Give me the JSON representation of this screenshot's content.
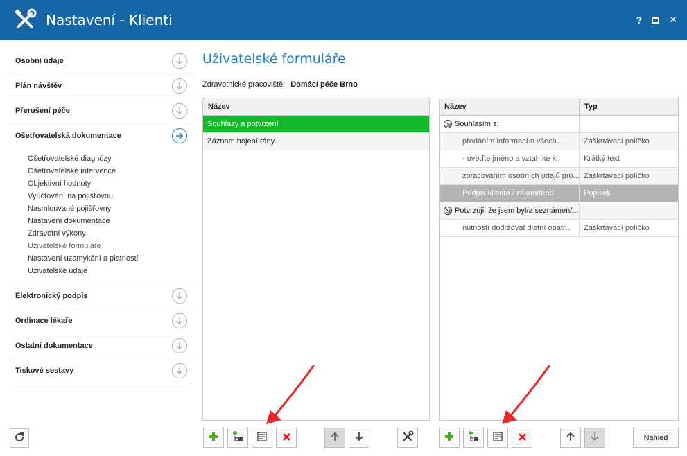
{
  "window": {
    "title": "Nastavení - Klienti",
    "help": "?",
    "close": "✕"
  },
  "sidebar": {
    "sections_top": [
      {
        "label": "Osobní údaje"
      },
      {
        "label": "Plán návštěv"
      },
      {
        "label": "Přerušení péče"
      },
      {
        "label": "Ošetřovatelská dokumentace"
      }
    ],
    "subitems": [
      "Ošetřovatelské diagnózy",
      "Ošetřovatelské intervence",
      "Objektivní hodnoty",
      "Vyúčtování na pojišťovnu",
      "Nasmlouvané pojišťovny",
      "Nastavení dokumentace",
      "Zdravotní výkony",
      "Uživatelské formuláře",
      "Nastavení uzamykání a platností",
      "Uživatelské údaje"
    ],
    "sections_bottom": [
      {
        "label": "Elektronický podpis"
      },
      {
        "label": "Ordinace lékaře"
      },
      {
        "label": "Ostatní dokumentace"
      },
      {
        "label": "Tiskové sestavy"
      }
    ]
  },
  "main": {
    "title": "Uživatelské formuláře",
    "workplace_label": "Zdravotnické pracoviště:",
    "workplace_value": "Domácí péče Brno"
  },
  "forms": {
    "header": "Název",
    "rows": [
      "Souhlasy a potvrzení",
      "Záznam hojení rány"
    ]
  },
  "items": {
    "headers": {
      "name": "Název",
      "type": "Typ"
    },
    "rows": [
      {
        "name": "Souhlasím s:",
        "type": ""
      },
      {
        "name": "předáním informací o všech...",
        "type": "Zaškrtávací políčko"
      },
      {
        "name": "- uveďte jméno a vztah ke kl.",
        "type": "Krátký text"
      },
      {
        "name": "zpracováním osobních údajů pro...",
        "type": "Zaškrtávací políčko"
      },
      {
        "name": "Podpis klienta / zákonného...",
        "type": "Popisek"
      },
      {
        "name": "Potvrzuji, že jsem byl/a seznámen/...",
        "type": ""
      },
      {
        "name": "nutností dodržovat dietní opatř...",
        "type": "Zaškrtávací políčko"
      }
    ]
  },
  "toolbar": {
    "preview_label": "Náhled"
  },
  "colors": {
    "titlebar": "#1565a7",
    "accent": "#1e7fc4",
    "selected": "#13b82b",
    "arrow": "#e8262b"
  }
}
